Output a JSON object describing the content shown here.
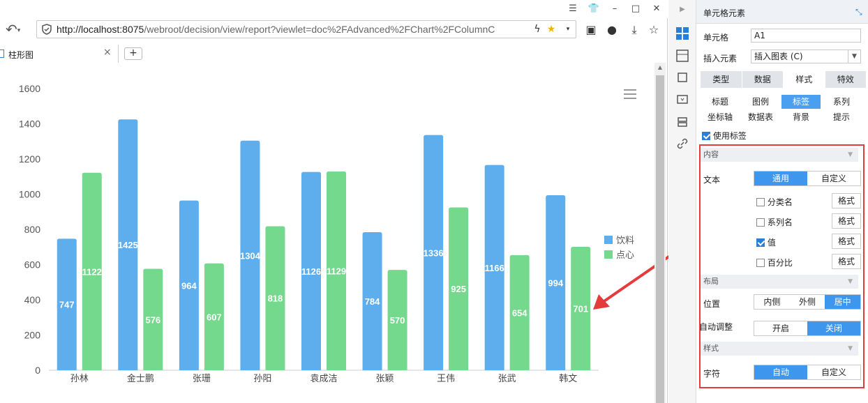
{
  "browser": {
    "url_host": "http://localhost:8075",
    "url_path": "/webroot/decision/view/report?viewlet=doc%2FAdvanced%2FChart%2FColumnC",
    "tab_label": "柱形图",
    "tab_plus": "+",
    "close_glyph": "×"
  },
  "chart_data": {
    "type": "bar",
    "categories": [
      "孙林",
      "金士鹏",
      "张珊",
      "孙阳",
      "袁成洁",
      "张颖",
      "王伟",
      "张武",
      "韩文"
    ],
    "series": [
      {
        "name": "饮料",
        "values": [
          747,
          1425,
          964,
          1304,
          1126,
          784,
          1336,
          1166,
          994
        ],
        "color": "#5eaeed"
      },
      {
        "name": "点心",
        "values": [
          1122,
          576,
          607,
          818,
          1129,
          570,
          925,
          654,
          701
        ],
        "color": "#74d98c"
      }
    ],
    "ylim": [
      0,
      1600
    ],
    "yticks": [
      0,
      200,
      400,
      600,
      800,
      1000,
      1200,
      1400,
      1600
    ],
    "legend_position": "right",
    "data_labels": true
  },
  "panel": {
    "title": "单元格元素",
    "cell_label": "单元格",
    "cell_value": "A1",
    "insert_label": "插入元素",
    "insert_value": "插入图表 (C)",
    "main_tabs": [
      "类型",
      "数据",
      "样式",
      "特效"
    ],
    "active_main_tab": "样式",
    "sub_tabs": [
      "标题",
      "图例",
      "标签",
      "系列",
      "坐标轴",
      "数据表",
      "背景",
      "提示"
    ],
    "active_sub_tab": "标签",
    "use_label": "使用标签",
    "sec_content": "内容",
    "text_label": "文本",
    "text_options": [
      "通用",
      "自定义"
    ],
    "opt_category": "分类名",
    "opt_series": "系列名",
    "opt_value": "值",
    "opt_percent": "百分比",
    "format_btn": "格式",
    "sec_layout": "布局",
    "position_label": "位置",
    "position_options": [
      "内侧",
      "外侧",
      "居中"
    ],
    "auto_adjust_label": "自动调整",
    "auto_adjust_options": [
      "开启",
      "关闭"
    ],
    "sec_style": "样式",
    "char_label": "字符",
    "char_options": [
      "自动",
      "自定义"
    ]
  }
}
